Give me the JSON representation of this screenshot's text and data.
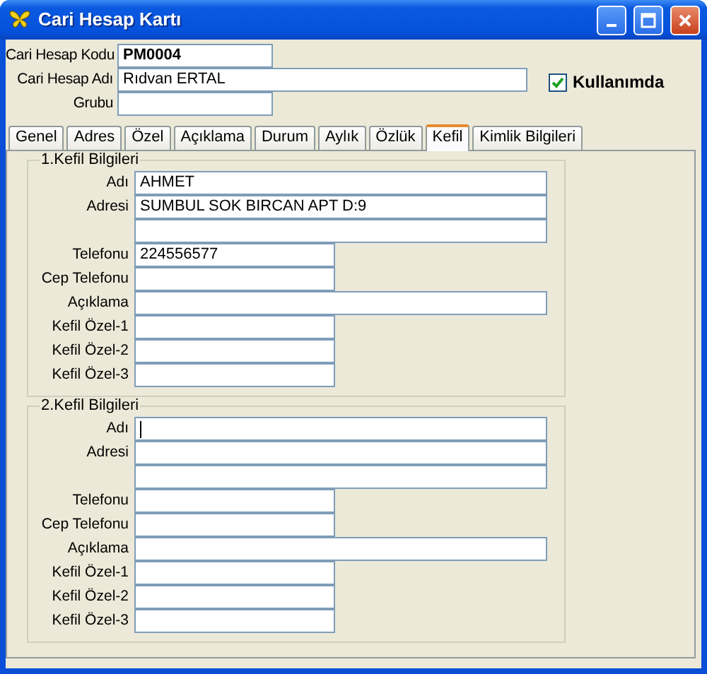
{
  "window": {
    "title": "Cari Hesap Kartı"
  },
  "header": {
    "fields": [
      {
        "label": "Cari Hesap Kodu",
        "value": "PM0004",
        "bold": true,
        "kind": "short"
      },
      {
        "label": "Cari Hesap Adı",
        "value": "Rıdvan ERTAL",
        "bold": false,
        "kind": "wide"
      },
      {
        "label": "Grubu",
        "kind": "short"
      }
    ],
    "checkbox": {
      "label": "Kullanımda",
      "checked": true
    }
  },
  "tabs": [
    {
      "label": "Genel",
      "selected": false
    },
    {
      "label": "Adres",
      "selected": false
    },
    {
      "label": "Özel",
      "selected": false
    },
    {
      "label": "Açıklama",
      "selected": false
    },
    {
      "label": "Durum",
      "selected": false
    },
    {
      "label": "Aylık",
      "selected": false
    },
    {
      "label": "Özlük",
      "selected": false
    },
    {
      "label": "Kefil",
      "selected": true
    },
    {
      "label": "Kimlik Bilgileri",
      "selected": false
    }
  ],
  "groups": [
    {
      "title": "1.Kefil Bilgileri",
      "fields": [
        {
          "label": "Adı",
          "value": "AHMET",
          "kind": "wide"
        },
        {
          "label": "Adresi",
          "value": "SUMBUL SOK BIRCAN APT D:9",
          "kind": "wide"
        },
        {
          "kind": "wide"
        },
        {
          "label": "Telefonu",
          "value": "224556577",
          "kind": "short"
        },
        {
          "label": "Cep Telefonu",
          "kind": "short"
        },
        {
          "label": "Açıklama",
          "kind": "wide"
        },
        {
          "label": "Kefil Özel-1",
          "kind": "short"
        },
        {
          "label": "Kefil Özel-2",
          "kind": "short"
        },
        {
          "label": "Kefil Özel-3",
          "kind": "short"
        }
      ]
    },
    {
      "title": "2.Kefil Bilgileri",
      "fields": [
        {
          "label": "Adı",
          "kind": "wide",
          "focused": true
        },
        {
          "label": "Adresi",
          "kind": "wide"
        },
        {
          "kind": "wide"
        },
        {
          "label": "Telefonu",
          "kind": "short"
        },
        {
          "label": "Cep Telefonu",
          "kind": "short"
        },
        {
          "label": "Açıklama",
          "kind": "wide"
        },
        {
          "label": "Kefil Özel-1",
          "kind": "short"
        },
        {
          "label": "Kefil Özel-2",
          "kind": "short"
        },
        {
          "label": "Kefil Özel-3",
          "kind": "short"
        }
      ]
    }
  ]
}
